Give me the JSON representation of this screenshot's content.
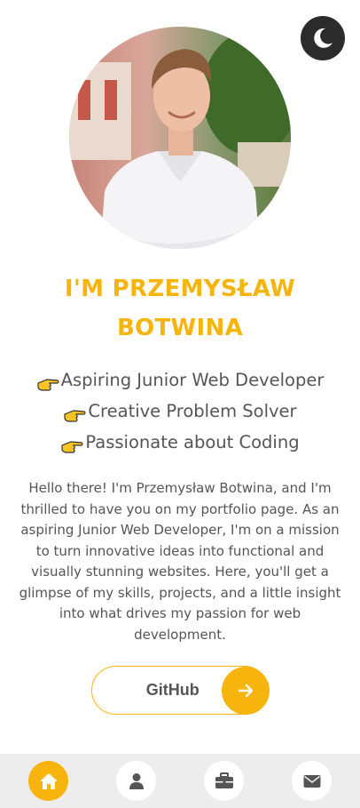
{
  "header": {
    "theme_toggle_icon": "moon-icon"
  },
  "hero": {
    "title_line1": "I'M PRZEMYSŁAW",
    "title_line2": "BOTWINA",
    "traits": [
      {
        "icon": "pointing-hand-icon",
        "label": "Aspiring Junior Web Developer"
      },
      {
        "icon": "pointing-hand-icon",
        "label": "Creative Problem Solver"
      },
      {
        "icon": "pointing-hand-icon",
        "label": "Passionate about Coding"
      }
    ],
    "intro": "Hello there! I'm Przemysław Botwina, and I'm thrilled to have you on my portfolio page. As an aspiring Junior Web Developer, I'm on a mission to turn innovative ideas into functional and visually stunning websites. Here, you'll get a glimpse of my skills, projects, and a little insight into what drives my passion for web development.",
    "github_label": "GitHub",
    "github_icon": "arrow-right-icon"
  },
  "nav": {
    "items": [
      {
        "icon": "home-icon",
        "active": true
      },
      {
        "icon": "user-icon",
        "active": false
      },
      {
        "icon": "briefcase-icon",
        "active": false
      },
      {
        "icon": "envelope-icon",
        "active": false
      }
    ]
  },
  "colors": {
    "accent": "#f7b40c",
    "text": "#555555",
    "toggle_bg": "#2b2b2b",
    "nav_bg": "#ededed"
  }
}
